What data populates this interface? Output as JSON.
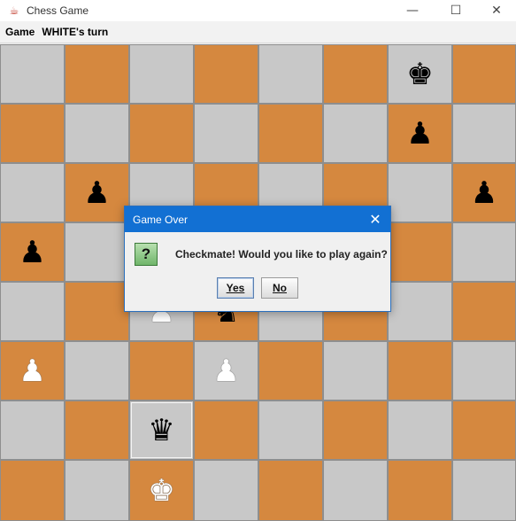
{
  "window": {
    "title": "Chess Game",
    "app_icon": "java-icon",
    "controls": {
      "minimize": "—",
      "maximize": "☐",
      "close": "✕"
    }
  },
  "menubar": {
    "game_menu": "Game",
    "turn_label": "WHITE's turn"
  },
  "board": {
    "light_color": "#c8c8c8",
    "dark_color": "#d5883f",
    "selected_square": "c2",
    "pieces": [
      {
        "square": "g8",
        "piece": "king",
        "color": "black",
        "glyph": "♚"
      },
      {
        "square": "g7",
        "piece": "pawn",
        "color": "black",
        "glyph": "♟"
      },
      {
        "square": "b6",
        "piece": "pawn",
        "color": "black",
        "glyph": "♟"
      },
      {
        "square": "h6",
        "piece": "pawn",
        "color": "black",
        "glyph": "♟"
      },
      {
        "square": "a5",
        "piece": "pawn",
        "color": "black",
        "glyph": "♟"
      },
      {
        "square": "c4",
        "piece": "pawn",
        "color": "white",
        "glyph": "♟"
      },
      {
        "square": "d4",
        "piece": "knight",
        "color": "black",
        "glyph": "♞"
      },
      {
        "square": "a3",
        "piece": "pawn",
        "color": "white",
        "glyph": "♟"
      },
      {
        "square": "d3",
        "piece": "pawn",
        "color": "white",
        "glyph": "♟"
      },
      {
        "square": "c2",
        "piece": "queen",
        "color": "black",
        "glyph": "♛"
      },
      {
        "square": "c1",
        "piece": "king",
        "color": "white",
        "glyph": "♚"
      }
    ]
  },
  "dialog": {
    "title": "Game Over",
    "close_glyph": "✕",
    "icon": "question-icon",
    "icon_glyph": "?",
    "message": "Checkmate! Would you like to play again?",
    "yes_label": "Yes",
    "no_label": "No"
  }
}
